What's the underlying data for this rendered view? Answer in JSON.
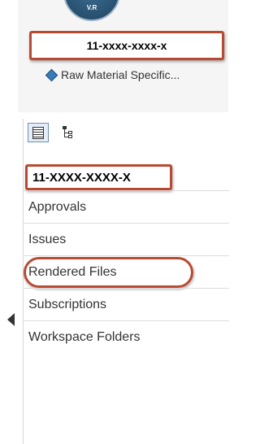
{
  "header": {
    "logo_text": "V.R",
    "object_id": "11-xxxx-xxxx-x",
    "object_type_label": "Raw Material Specific..."
  },
  "sidebar": {
    "selected_id": "11-XXXX-XXXX-X",
    "items": [
      {
        "label": "Approvals"
      },
      {
        "label": "Issues"
      },
      {
        "label": "Rendered Files"
      },
      {
        "label": "Subscriptions"
      },
      {
        "label": "Workspace Folders"
      }
    ]
  },
  "colors": {
    "annotation_red": "#b84a32",
    "icon_blue": "#3a7ab8"
  }
}
